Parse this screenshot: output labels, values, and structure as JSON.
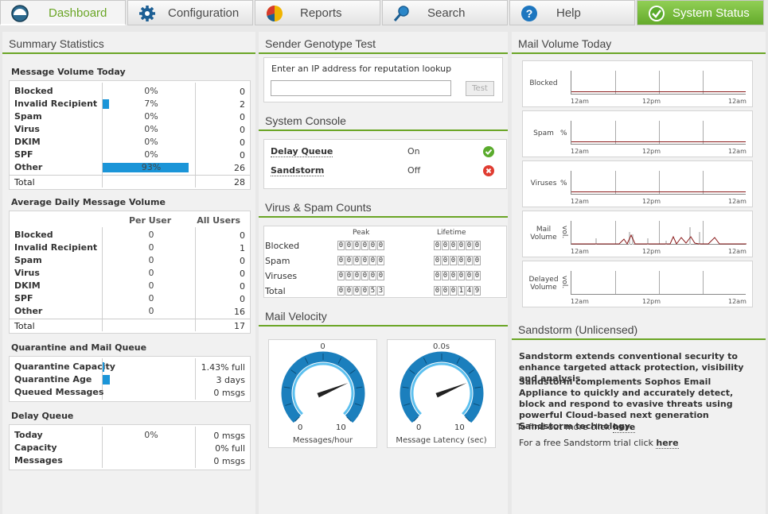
{
  "nav": {
    "tabs": [
      {
        "label": "Dashboard",
        "icon": "dashboard-icon"
      },
      {
        "label": "Configuration",
        "icon": "gear-icon"
      },
      {
        "label": "Reports",
        "icon": "pie-chart-icon"
      },
      {
        "label": "Search",
        "icon": "magnifier-icon"
      },
      {
        "label": "Help",
        "icon": "help-icon"
      },
      {
        "label": "System Status",
        "icon": "check-icon"
      }
    ]
  },
  "colors": {
    "accent": "#6aa525",
    "bar": "#1b95d8",
    "ok": "#5aab2c",
    "error": "#e03c31"
  },
  "summary": {
    "title": "Summary Statistics",
    "volume": {
      "title": "Message Volume Today",
      "rows": [
        {
          "label": "Blocked",
          "pct": "0%",
          "fraction": 0,
          "count": "0"
        },
        {
          "label": "Invalid Recipient",
          "pct": "7%",
          "fraction": 0.07,
          "count": "2"
        },
        {
          "label": "Spam",
          "pct": "0%",
          "fraction": 0,
          "count": "0"
        },
        {
          "label": "Virus",
          "pct": "0%",
          "fraction": 0,
          "count": "0"
        },
        {
          "label": "DKIM",
          "pct": "0%",
          "fraction": 0,
          "count": "0"
        },
        {
          "label": "SPF",
          "pct": "0%",
          "fraction": 0,
          "count": "0"
        },
        {
          "label": "Other",
          "pct": "93%",
          "fraction": 0.93,
          "count": "26"
        }
      ],
      "total_label": "Total",
      "total": "28"
    },
    "average": {
      "title": "Average Daily Message Volume",
      "col1": "Per User",
      "col2": "All Users",
      "rows": [
        {
          "label": "Blocked",
          "per_user": "0",
          "all": "0"
        },
        {
          "label": "Invalid Recipient",
          "per_user": "0",
          "all": "1"
        },
        {
          "label": "Spam",
          "per_user": "0",
          "all": "0"
        },
        {
          "label": "Virus",
          "per_user": "0",
          "all": "0"
        },
        {
          "label": "DKIM",
          "per_user": "0",
          "all": "0"
        },
        {
          "label": "SPF",
          "per_user": "0",
          "all": "0"
        },
        {
          "label": "Other",
          "per_user": "0",
          "all": "16"
        }
      ],
      "total_label": "Total",
      "total": "17"
    },
    "quarantine": {
      "title": "Quarantine and Mail Queue",
      "rows": [
        {
          "label": "Quarantine Capacity",
          "fraction": 0.0143,
          "value": "1.43% full"
        },
        {
          "label": "Quarantine Age",
          "fraction": 0.08,
          "value": "3 days"
        },
        {
          "label": "Queued Messages",
          "fraction": 0,
          "value": "0 msgs"
        }
      ]
    },
    "delay": {
      "title": "Delay Queue",
      "pct": "0%",
      "rows": [
        {
          "label": "Today",
          "value": "0 msgs"
        },
        {
          "label": "Capacity",
          "value": "0% full"
        },
        {
          "label": "Messages",
          "value": "0 msgs"
        }
      ]
    }
  },
  "genotype": {
    "title": "Sender Genotype Test",
    "prompt": "Enter an IP address for reputation lookup",
    "input_value": "",
    "button": "Test"
  },
  "console": {
    "title": "System Console",
    "rows": [
      {
        "label": "Delay Queue",
        "state": "On",
        "icon": "check-icon"
      },
      {
        "label": "Sandstorm",
        "state": "Off",
        "icon": "error-x-icon"
      }
    ]
  },
  "counts": {
    "title": "Virus & Spam Counts",
    "peak_label": "Peak",
    "lifetime_label": "Lifetime",
    "rows": [
      {
        "label": "Blocked",
        "peak": "000000",
        "lifetime": "000000"
      },
      {
        "label": "Spam",
        "peak": "000000",
        "lifetime": "000000"
      },
      {
        "label": "Viruses",
        "peak": "000000",
        "lifetime": "000000"
      },
      {
        "label": "Total",
        "peak": "000053",
        "lifetime": "000149"
      }
    ]
  },
  "velocity": {
    "title": "Mail Velocity",
    "gauges": [
      {
        "value_label": "0",
        "min": "0",
        "max": "10",
        "caption": "Messages/hour",
        "reading": 0.75
      },
      {
        "value_label": "0.0s",
        "min": "0",
        "max": "10",
        "caption": "Message Latency (sec)",
        "reading": 0.75
      }
    ]
  },
  "mailvolume": {
    "title": "Mail Volume Today",
    "ticks": [
      "12am",
      "12pm",
      "12am"
    ],
    "graphs": [
      {
        "label": "Blocked",
        "unit": ""
      },
      {
        "label": "Spam",
        "unit": "%"
      },
      {
        "label": "Viruses",
        "unit": "%"
      },
      {
        "label": "Mail Volume",
        "unit": "vol."
      },
      {
        "label": "Delayed Volume",
        "unit": "vol."
      }
    ]
  },
  "sandstorm": {
    "title": "Sandstorm (Unlicensed)",
    "p1": "Sandstorm extends conventional security to enhance targeted attack protection, visibility and analysis.",
    "p2": "Sandstorm complements Sophos Email Appliance to quickly and accurately detect, block and respond to evasive threats using powerful Cloud-based next generation Sandstorm technology.",
    "more_prefix": "To find out more click ",
    "more_link": "here",
    "trial_prefix": "For a free Sandstorm trial click ",
    "trial_link": "here"
  }
}
